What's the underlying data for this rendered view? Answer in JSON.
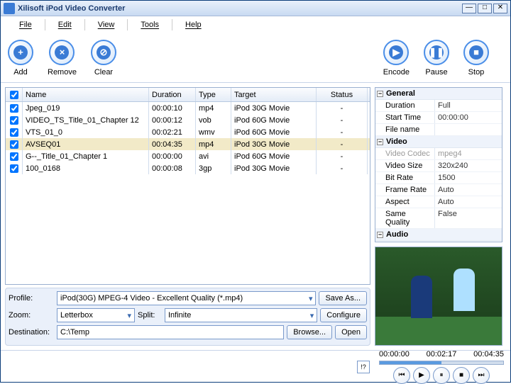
{
  "title": "Xilisoft iPod Video Converter",
  "menu": [
    "File",
    "Edit",
    "View",
    "Tools",
    "Help"
  ],
  "toolbar": [
    {
      "label": "Add",
      "glyph": "+"
    },
    {
      "label": "Remove",
      "glyph": "×"
    },
    {
      "label": "Clear",
      "glyph": "⊘"
    },
    {
      "label": "Encode",
      "glyph": "▶"
    },
    {
      "label": "Pause",
      "glyph": "❚❚"
    },
    {
      "label": "Stop",
      "glyph": "■"
    }
  ],
  "columns": {
    "ck": "☑",
    "name": "Name",
    "duration": "Duration",
    "type": "Type",
    "target": "Target",
    "status": "Status"
  },
  "files": [
    {
      "name": "Jpeg_019",
      "duration": "00:00:10",
      "type": "mp4",
      "target": "iPod 30G Movie",
      "status": "-",
      "sel": false
    },
    {
      "name": "VIDEO_TS_Title_01_Chapter 12",
      "duration": "00:00:12",
      "type": "vob",
      "target": "iPod 60G Movie",
      "status": "-",
      "sel": false
    },
    {
      "name": "VTS_01_0",
      "duration": "00:02:21",
      "type": "wmv",
      "target": "iPod 60G Movie",
      "status": "-",
      "sel": false
    },
    {
      "name": "AVSEQ01",
      "duration": "00:04:35",
      "type": "mp4",
      "target": "iPod 30G Movie",
      "status": "-",
      "sel": true
    },
    {
      "name": "G--_Title_01_Chapter 1",
      "duration": "00:00:00",
      "type": "avi",
      "target": "iPod 60G Movie",
      "status": "-",
      "sel": false
    },
    {
      "name": "100_0168",
      "duration": "00:00:08",
      "type": "3gp",
      "target": "iPod 30G Movie",
      "status": "-",
      "sel": false
    }
  ],
  "form": {
    "profile_lbl": "Profile:",
    "profile": "iPod(30G) MPEG-4 Video - Excellent Quality  (*.mp4)",
    "saveas": "Save As...",
    "zoom_lbl": "Zoom:",
    "zoom": "Letterbox",
    "split_lbl": "Split:",
    "split": "Infinite",
    "configure": "Configure",
    "dest_lbl": "Destination:",
    "dest": "C:\\Temp",
    "browse": "Browse...",
    "open": "Open"
  },
  "props": {
    "groups": [
      {
        "name": "General",
        "rows": [
          [
            "Duration",
            "Full"
          ],
          [
            "Start Time",
            "00:00:00"
          ],
          [
            "File name",
            ""
          ]
        ]
      },
      {
        "name": "Video",
        "rows": [
          [
            "Video Codec",
            "mpeg4",
            "dim"
          ],
          [
            "Video Size",
            "320x240"
          ],
          [
            "Bit Rate",
            "1500"
          ],
          [
            "Frame Rate",
            "Auto"
          ],
          [
            "Aspect",
            "Auto"
          ],
          [
            "Same Quality",
            "False"
          ]
        ]
      },
      {
        "name": "Audio",
        "rows": []
      }
    ]
  },
  "player": {
    "t0": "00:00:00",
    "t1": "00:02:17",
    "t2": "00:04:35"
  },
  "help": "!?"
}
